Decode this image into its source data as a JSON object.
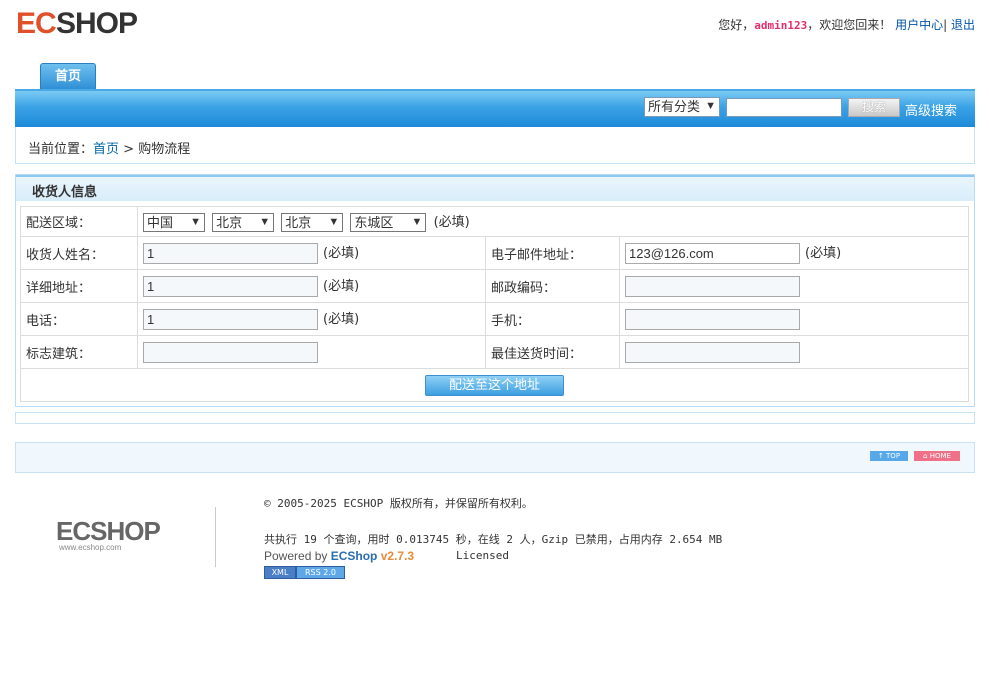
{
  "header": {
    "logo_text": "ECSHOP",
    "greeting": "您好，",
    "username": "admin123",
    "welcome": "，欢迎您回来！",
    "user_center": "用户中心",
    "separator": "|",
    "logout": "退出"
  },
  "nav": {
    "tabs": [
      {
        "label": "首页"
      }
    ],
    "category_select": "所有分类",
    "search_value": "",
    "search_button": "搜索",
    "advanced_search": "高级搜索"
  },
  "breadcrumb": {
    "prefix": "当前位置：",
    "home": "首页",
    "arrow": ">",
    "current": "购物流程"
  },
  "consignee": {
    "title": "收货人信息",
    "region_label": "配送区域：",
    "regions": [
      "中国",
      "北京",
      "北京",
      "东城区"
    ],
    "required": "(必填)",
    "name_label": "收货人姓名：",
    "name_value": "1",
    "email_label": "电子邮件地址：",
    "email_value": "123@126.com",
    "address_label": "详细地址：",
    "address_value": "1",
    "zipcode_label": "邮政编码：",
    "zipcode_value": "",
    "tel_label": "电话：",
    "tel_value": "1",
    "mobile_label": "手机：",
    "mobile_value": "",
    "building_label": "标志建筑：",
    "building_value": "",
    "best_time_label": "最佳送货时间：",
    "best_time_value": "",
    "submit": "配送至这个地址"
  },
  "footer": {
    "top_button": "↑ TOP",
    "home_button": "⌂ HOME",
    "logo_text": "ECSHOP",
    "logo_url": "www.ecshop.com",
    "copyright": "© 2005-2025 ECSHOP 版权所有，并保留所有权利。",
    "stats": "共执行 19 个查询，用时 0.013745 秒，在线 2 人，Gzip 已禁用，占用内存 2.654 MB",
    "powered_by": "Powered by",
    "brand": "ECShop",
    "version": "v2.7.3",
    "licensed": "Licensed",
    "xml_badge": "XML",
    "rss_badge": "RSS 2.0"
  },
  "colors": {
    "nav_blue": "#1e8ad8",
    "link_blue": "#0066aa",
    "username_pink": "#e0306a",
    "version_orange": "#e88a3a"
  }
}
